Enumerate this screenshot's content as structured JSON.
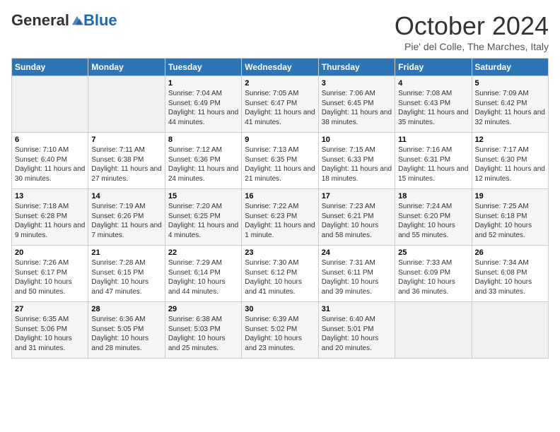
{
  "logo": {
    "general": "General",
    "blue": "Blue"
  },
  "title": "October 2024",
  "subtitle": "Pie' del Colle, The Marches, Italy",
  "days_header": [
    "Sunday",
    "Monday",
    "Tuesday",
    "Wednesday",
    "Thursday",
    "Friday",
    "Saturday"
  ],
  "weeks": [
    [
      {
        "num": "",
        "text": "",
        "empty": true
      },
      {
        "num": "",
        "text": "",
        "empty": true
      },
      {
        "num": "1",
        "text": "Sunrise: 7:04 AM\nSunset: 6:49 PM\nDaylight: 11 hours and 44 minutes."
      },
      {
        "num": "2",
        "text": "Sunrise: 7:05 AM\nSunset: 6:47 PM\nDaylight: 11 hours and 41 minutes."
      },
      {
        "num": "3",
        "text": "Sunrise: 7:06 AM\nSunset: 6:45 PM\nDaylight: 11 hours and 38 minutes."
      },
      {
        "num": "4",
        "text": "Sunrise: 7:08 AM\nSunset: 6:43 PM\nDaylight: 11 hours and 35 minutes."
      },
      {
        "num": "5",
        "text": "Sunrise: 7:09 AM\nSunset: 6:42 PM\nDaylight: 11 hours and 32 minutes."
      }
    ],
    [
      {
        "num": "6",
        "text": "Sunrise: 7:10 AM\nSunset: 6:40 PM\nDaylight: 11 hours and 30 minutes."
      },
      {
        "num": "7",
        "text": "Sunrise: 7:11 AM\nSunset: 6:38 PM\nDaylight: 11 hours and 27 minutes."
      },
      {
        "num": "8",
        "text": "Sunrise: 7:12 AM\nSunset: 6:36 PM\nDaylight: 11 hours and 24 minutes."
      },
      {
        "num": "9",
        "text": "Sunrise: 7:13 AM\nSunset: 6:35 PM\nDaylight: 11 hours and 21 minutes."
      },
      {
        "num": "10",
        "text": "Sunrise: 7:15 AM\nSunset: 6:33 PM\nDaylight: 11 hours and 18 minutes."
      },
      {
        "num": "11",
        "text": "Sunrise: 7:16 AM\nSunset: 6:31 PM\nDaylight: 11 hours and 15 minutes."
      },
      {
        "num": "12",
        "text": "Sunrise: 7:17 AM\nSunset: 6:30 PM\nDaylight: 11 hours and 12 minutes."
      }
    ],
    [
      {
        "num": "13",
        "text": "Sunrise: 7:18 AM\nSunset: 6:28 PM\nDaylight: 11 hours and 9 minutes."
      },
      {
        "num": "14",
        "text": "Sunrise: 7:19 AM\nSunset: 6:26 PM\nDaylight: 11 hours and 7 minutes."
      },
      {
        "num": "15",
        "text": "Sunrise: 7:20 AM\nSunset: 6:25 PM\nDaylight: 11 hours and 4 minutes."
      },
      {
        "num": "16",
        "text": "Sunrise: 7:22 AM\nSunset: 6:23 PM\nDaylight: 11 hours and 1 minute."
      },
      {
        "num": "17",
        "text": "Sunrise: 7:23 AM\nSunset: 6:21 PM\nDaylight: 10 hours and 58 minutes."
      },
      {
        "num": "18",
        "text": "Sunrise: 7:24 AM\nSunset: 6:20 PM\nDaylight: 10 hours and 55 minutes."
      },
      {
        "num": "19",
        "text": "Sunrise: 7:25 AM\nSunset: 6:18 PM\nDaylight: 10 hours and 52 minutes."
      }
    ],
    [
      {
        "num": "20",
        "text": "Sunrise: 7:26 AM\nSunset: 6:17 PM\nDaylight: 10 hours and 50 minutes."
      },
      {
        "num": "21",
        "text": "Sunrise: 7:28 AM\nSunset: 6:15 PM\nDaylight: 10 hours and 47 minutes."
      },
      {
        "num": "22",
        "text": "Sunrise: 7:29 AM\nSunset: 6:14 PM\nDaylight: 10 hours and 44 minutes."
      },
      {
        "num": "23",
        "text": "Sunrise: 7:30 AM\nSunset: 6:12 PM\nDaylight: 10 hours and 41 minutes."
      },
      {
        "num": "24",
        "text": "Sunrise: 7:31 AM\nSunset: 6:11 PM\nDaylight: 10 hours and 39 minutes."
      },
      {
        "num": "25",
        "text": "Sunrise: 7:33 AM\nSunset: 6:09 PM\nDaylight: 10 hours and 36 minutes."
      },
      {
        "num": "26",
        "text": "Sunrise: 7:34 AM\nSunset: 6:08 PM\nDaylight: 10 hours and 33 minutes."
      }
    ],
    [
      {
        "num": "27",
        "text": "Sunrise: 6:35 AM\nSunset: 5:06 PM\nDaylight: 10 hours and 31 minutes."
      },
      {
        "num": "28",
        "text": "Sunrise: 6:36 AM\nSunset: 5:05 PM\nDaylight: 10 hours and 28 minutes."
      },
      {
        "num": "29",
        "text": "Sunrise: 6:38 AM\nSunset: 5:03 PM\nDaylight: 10 hours and 25 minutes."
      },
      {
        "num": "30",
        "text": "Sunrise: 6:39 AM\nSunset: 5:02 PM\nDaylight: 10 hours and 23 minutes."
      },
      {
        "num": "31",
        "text": "Sunrise: 6:40 AM\nSunset: 5:01 PM\nDaylight: 10 hours and 20 minutes."
      },
      {
        "num": "",
        "text": "",
        "empty": true
      },
      {
        "num": "",
        "text": "",
        "empty": true
      }
    ]
  ]
}
